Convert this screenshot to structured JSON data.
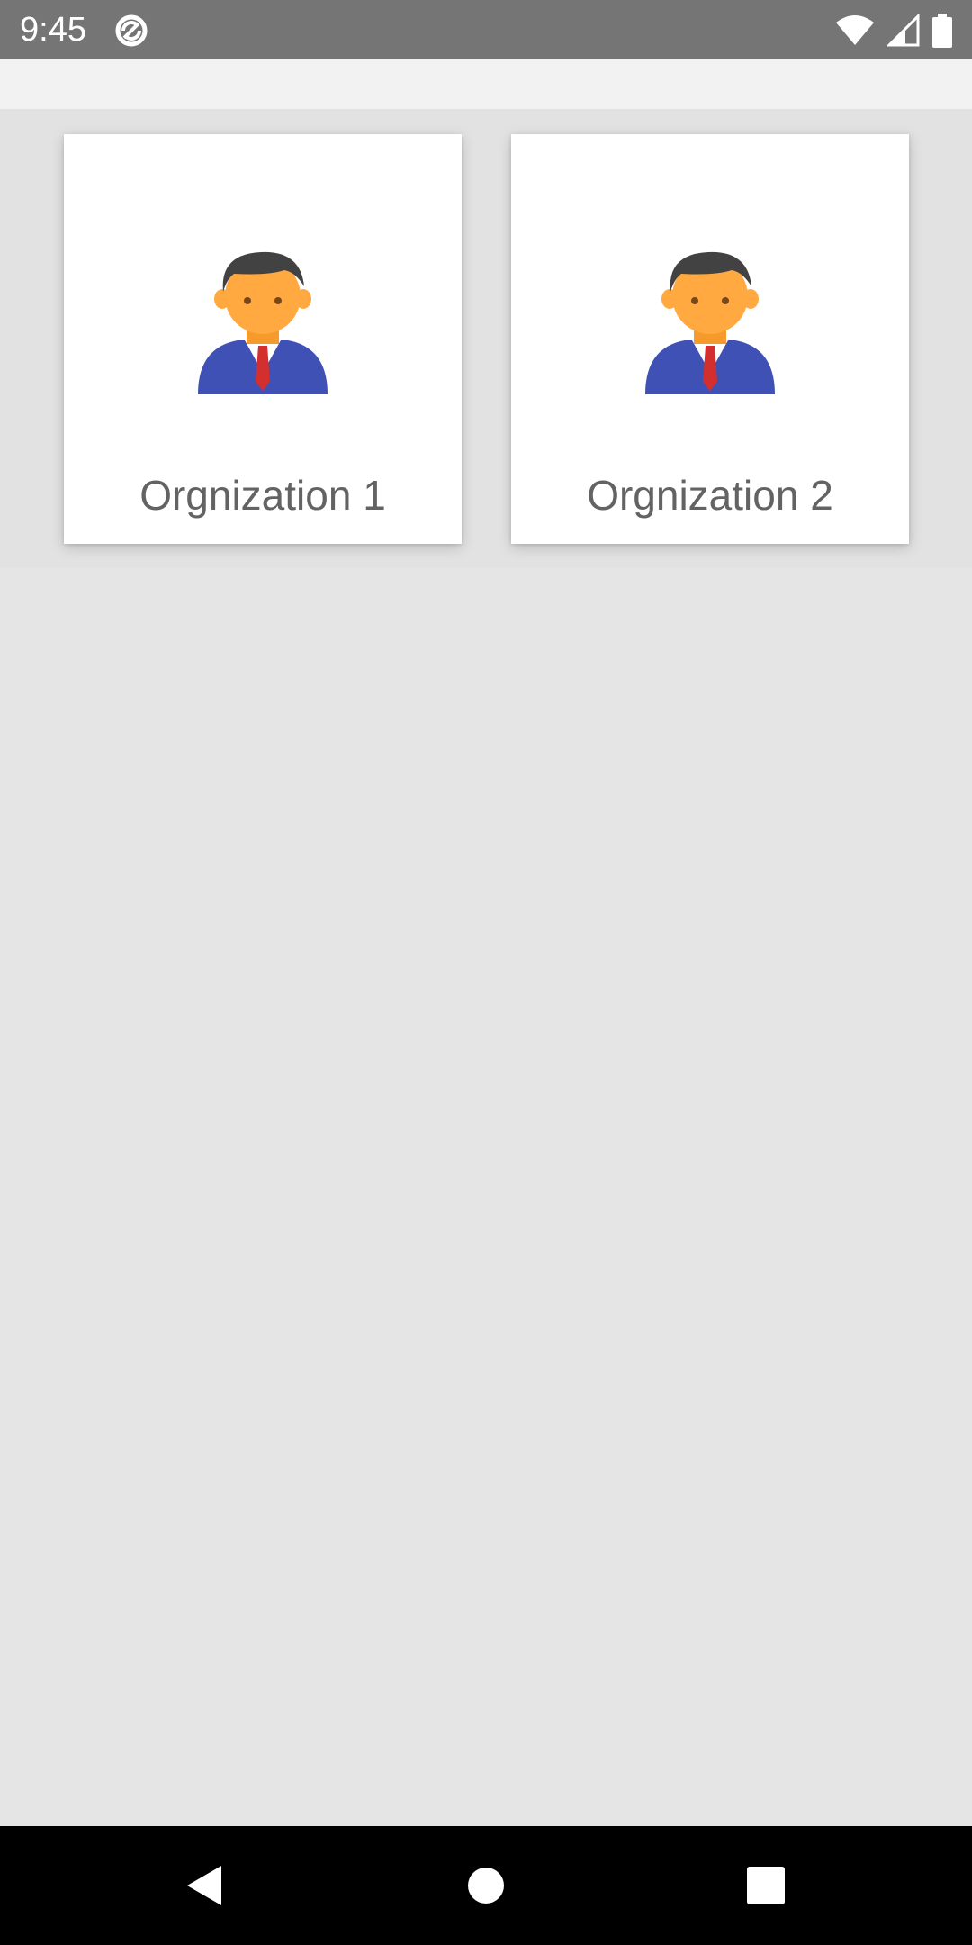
{
  "status_bar": {
    "time": "9:45",
    "icons": [
      "sync-icon",
      "wifi-icon",
      "cell-signal-icon",
      "battery-icon"
    ],
    "background": "#757575"
  },
  "organizations": [
    {
      "label": "Orgnization 1",
      "icon": "businessman-avatar-icon"
    },
    {
      "label": "Orgnization 2",
      "icon": "businessman-avatar-icon"
    }
  ],
  "nav_bar": {
    "buttons": [
      "back-icon",
      "home-icon",
      "recents-icon"
    ]
  },
  "colors": {
    "card_background": "#ffffff",
    "page_background": "#e5e5e5",
    "label_text": "#636363",
    "avatar_suit": "#3f51b5",
    "avatar_skin": "#ffa940",
    "avatar_hair": "#424242",
    "avatar_tie": "#d32f2f"
  }
}
